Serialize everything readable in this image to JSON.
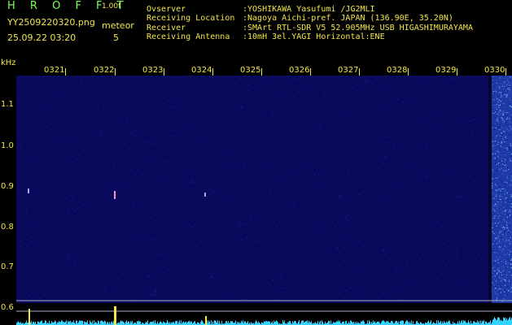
{
  "header": {
    "title": "H R O F F T",
    "version": "1.00f",
    "filename": "YY2509220320.png",
    "meteor_label": "meteor",
    "datetime": "25.09.22 03:20",
    "meteor_count": "5"
  },
  "info": {
    "observer_label": "Ovserver",
    "observer_value": ":YOSHIKAWA Yasufumi /JG2MLI",
    "location_label": "Receiving Location",
    "location_value": ":Nagoya Aichi-pref. JAPAN (136.90E, 35.20N)",
    "receiver_label": "Receiver",
    "receiver_value": ":SMArt RTL-SDR V5 52.905MHz USB HIGASHIMURAYAMA",
    "antenna_label": "Receiving Antenna",
    "antenna_value": ":10mH 3el.YAGI Horizontal:ENE"
  },
  "axis": {
    "y_unit": "kHz",
    "y_ticks": [
      "1.1",
      "1.0",
      "0.9",
      "0.8",
      "0.7",
      "0.6"
    ],
    "x_ticks": [
      "0321",
      "0322",
      "0323",
      "0324",
      "0325",
      "0326",
      "0327",
      "0328",
      "0329",
      "0330"
    ]
  },
  "colors": {
    "background": "#000000",
    "label_green": "#7dff5a",
    "label_yellow": "#f2e64a",
    "waterfall": "#0a0a5c",
    "spectrum": "#35d3ff"
  }
}
